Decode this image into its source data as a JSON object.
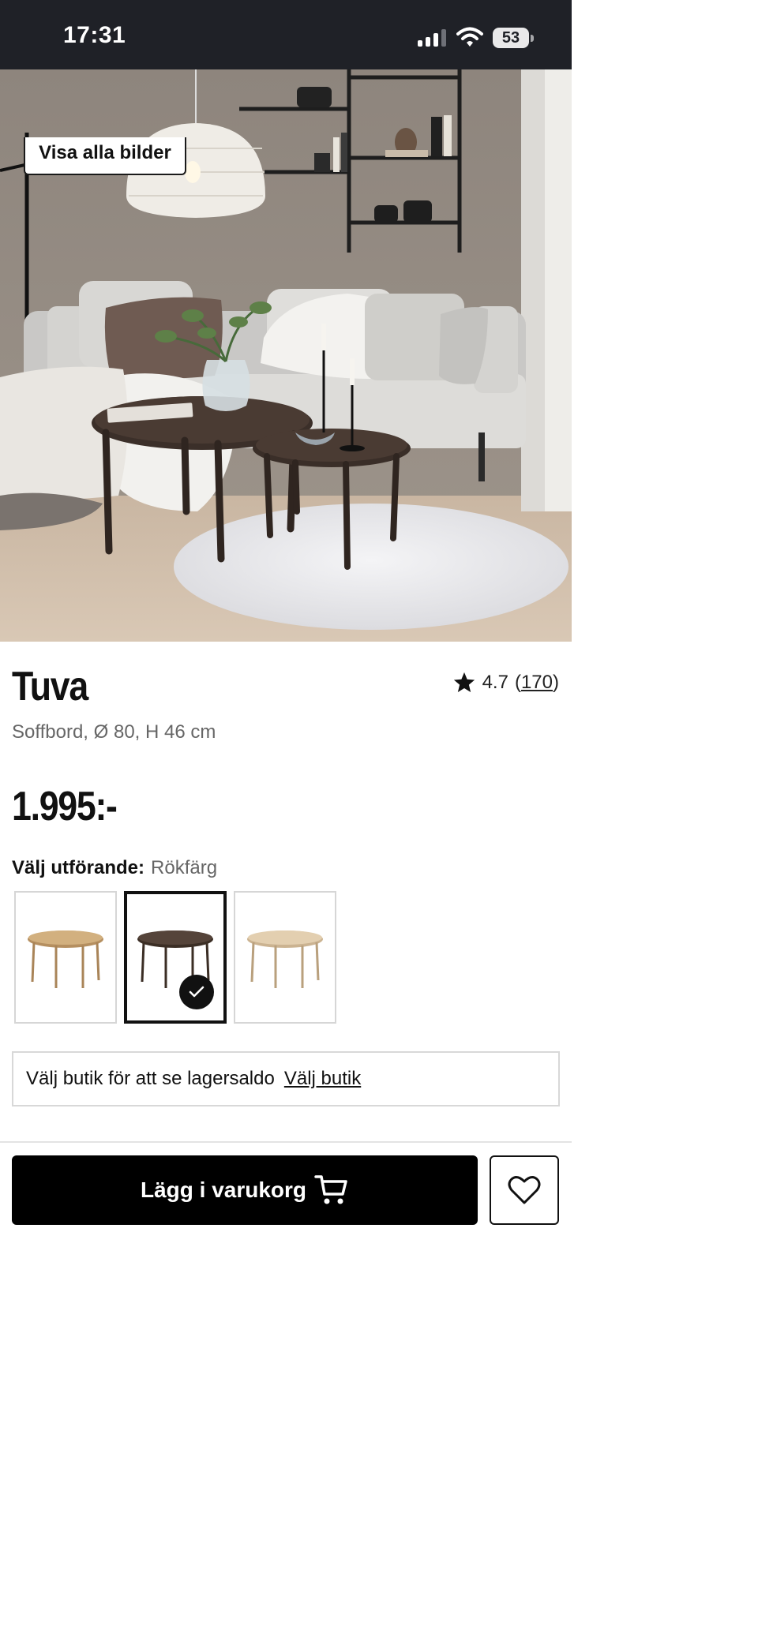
{
  "status_bar": {
    "time": "17:31",
    "battery": "53",
    "icons": [
      "signal-icon",
      "wifi-icon",
      "battery-icon"
    ]
  },
  "gallery": {
    "show_all_label": "Visa alla bilder"
  },
  "product": {
    "name": "Tuva",
    "subtitle": "Soffbord, Ø 80, H 46 cm",
    "price": "1.995:-",
    "rating": {
      "value": "4.7",
      "count": "170",
      "open_paren": "(",
      "close_paren": ")",
      "icon": "star-icon"
    }
  },
  "variant": {
    "label": "Välj utförande:",
    "selected": "Rökfärg",
    "options": [
      {
        "icon": "table-oak-thumbnail",
        "color": "#c9a77c",
        "selected": false
      },
      {
        "icon": "table-smoked-thumbnail",
        "color": "#4a3a2e",
        "selected": true
      },
      {
        "icon": "table-white-oak-thumbnail",
        "color": "#dcc6a6",
        "selected": false
      }
    ]
  },
  "store": {
    "text": "Välj butik för att se lagersaldo",
    "link": "Välj butik"
  },
  "actions": {
    "add_to_cart": "Lägg i varukorg",
    "cart_icon": "cart-icon",
    "favorite_icon": "heart-icon"
  },
  "colors": {
    "status_bar_bg": "#1f2127",
    "button_bg": "#000000",
    "text_secondary": "#666666",
    "border": "#d6d6d6"
  }
}
